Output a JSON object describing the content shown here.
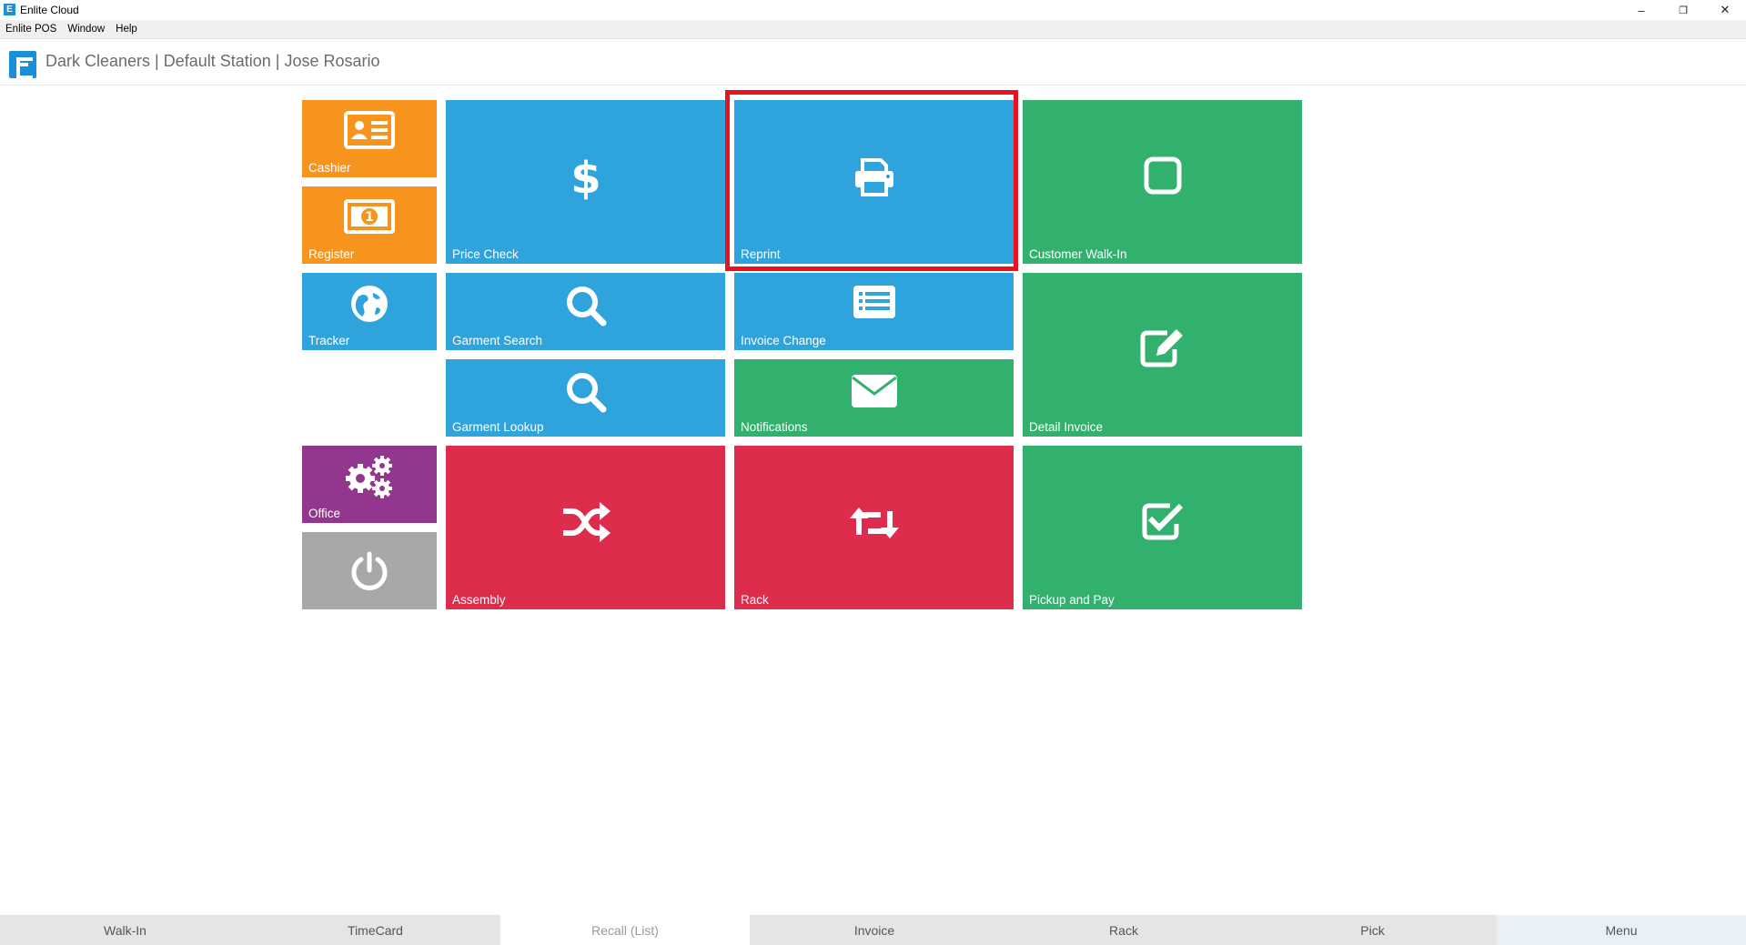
{
  "window": {
    "title": "Enlite Cloud",
    "logo_letter": "E",
    "controls": {
      "minimize": "–",
      "restore": "❐",
      "close": "✕"
    }
  },
  "menubar": {
    "items": [
      "Enlite POS",
      "Window",
      "Help"
    ]
  },
  "header": {
    "title": "Dark Cleaners | Default Station | Jose Rosario"
  },
  "tiles": {
    "cashier": {
      "label": "Cashier",
      "color": "#f7941e",
      "icon": "id-card-icon"
    },
    "register": {
      "label": "Register",
      "color": "#f7941e",
      "icon": "money-bill-icon"
    },
    "tracker": {
      "label": "Tracker",
      "color": "#2fa4dc",
      "icon": "globe-icon"
    },
    "office": {
      "label": "Office",
      "color": "#93378e",
      "icon": "gears-icon"
    },
    "power": {
      "label": "",
      "color": "#a7a8a8",
      "icon": "power-icon"
    },
    "price_check": {
      "label": "Price Check",
      "color": "#2fa4dc",
      "icon": "dollar-icon"
    },
    "reprint": {
      "label": "Reprint",
      "color": "#2fa4dc",
      "icon": "printer-icon",
      "highlighted": true
    },
    "customer_walk_in": {
      "label": "Customer Walk-In",
      "color": "#31b06e",
      "icon": "square-icon"
    },
    "garment_search": {
      "label": "Garment Search",
      "color": "#2fa4dc",
      "icon": "search-icon"
    },
    "invoice_change": {
      "label": "Invoice Change",
      "color": "#2fa4dc",
      "icon": "list-icon"
    },
    "detail_invoice": {
      "label": "Detail Invoice",
      "color": "#31b06e",
      "icon": "edit-icon"
    },
    "garment_lookup": {
      "label": "Garment Lookup",
      "color": "#2fa4dc",
      "icon": "search-icon"
    },
    "notifications": {
      "label": "Notifications",
      "color": "#31b06e",
      "icon": "envelope-icon"
    },
    "assembly": {
      "label": "Assembly",
      "color": "#dd2c4c",
      "icon": "shuffle-icon"
    },
    "rack": {
      "label": "Rack",
      "color": "#dd2c4c",
      "icon": "retweet-icon"
    },
    "pickup_and_pay": {
      "label": "Pickup and Pay",
      "color": "#31b06e",
      "icon": "check-square-icon"
    }
  },
  "bottom_tabs": [
    {
      "label": "Walk-In"
    },
    {
      "label": "TimeCard"
    },
    {
      "label": "Recall (List)",
      "active": true
    },
    {
      "label": "Invoice"
    },
    {
      "label": "Rack"
    },
    {
      "label": "Pick"
    },
    {
      "label": "Menu"
    }
  ]
}
